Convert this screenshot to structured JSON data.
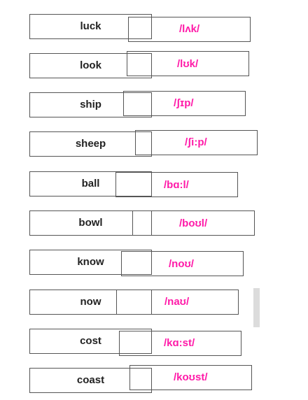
{
  "pairs": [
    {
      "word": "luck",
      "ipa": "/lʌk/"
    },
    {
      "word": "look",
      "ipa": "/lʊk/"
    },
    {
      "word": "ship",
      "ipa": "/ʃɪp/"
    },
    {
      "word": "sheep",
      "ipa": "/ʃi:p/"
    },
    {
      "word": "ball",
      "ipa": "/bɑ:l/"
    },
    {
      "word": "bowl",
      "ipa": "/boʊl/"
    },
    {
      "word": "know",
      "ipa": "/noʊ/"
    },
    {
      "word": "now",
      "ipa": "/naʊ/"
    },
    {
      "word": "cost",
      "ipa": "/kɑ:st/"
    },
    {
      "word": "coast",
      "ipa": "/koʊst/"
    }
  ],
  "colors": {
    "ipa": "#ff1aa8",
    "border": "#555555"
  }
}
